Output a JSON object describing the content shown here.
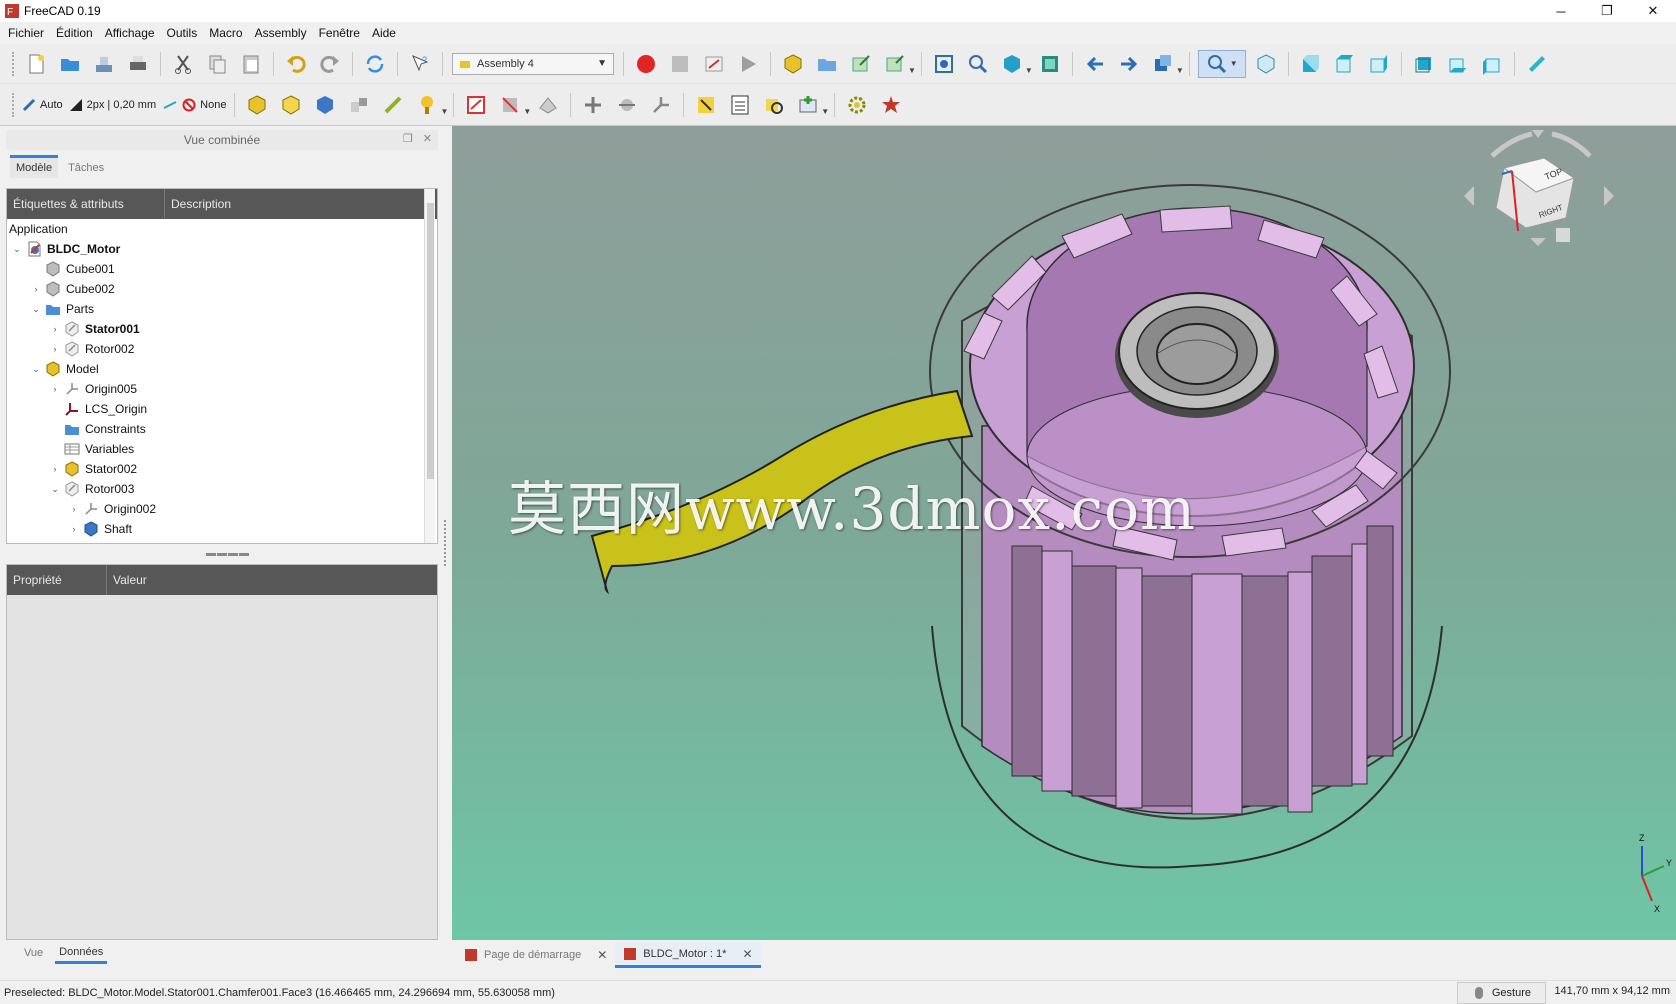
{
  "window": {
    "title": "FreeCAD 0.19",
    "minimize": "─",
    "restore": "❐",
    "close": "✕"
  },
  "menu": [
    "Fichier",
    "Édition",
    "Affichage",
    "Outils",
    "Macro",
    "Assembly",
    "Fenêtre",
    "Aide"
  ],
  "toolbar": {
    "workbench": "Assembly 4",
    "draw_mode": "Auto",
    "line_width": "2px | 0,20 mm",
    "grid_none": "None"
  },
  "combo_view": {
    "title": "Vue combinée",
    "tabs": [
      "Modèle",
      "Tâches"
    ],
    "tree_headers": [
      "Étiquettes & attributs",
      "Description"
    ],
    "tree": [
      {
        "label": "Application",
        "level": 0,
        "expander": "",
        "icon": "none",
        "bold": false
      },
      {
        "label": "BLDC_Motor",
        "level": 0,
        "expander": "v",
        "icon": "document",
        "bold": true
      },
      {
        "label": "Cube001",
        "level": 1,
        "expander": "",
        "icon": "cube-grey",
        "bold": false
      },
      {
        "label": "Cube002",
        "level": 1,
        "expander": ">",
        "icon": "cube-grey",
        "bold": false
      },
      {
        "label": "Parts",
        "level": 1,
        "expander": "v",
        "icon": "folder-blue",
        "bold": false
      },
      {
        "label": "Stator001",
        "level": 2,
        "expander": ">",
        "icon": "link-part",
        "bold": true
      },
      {
        "label": "Rotor002",
        "level": 2,
        "expander": ">",
        "icon": "link-part",
        "bold": false
      },
      {
        "label": "Model",
        "level": 1,
        "expander": "v",
        "icon": "model-yellow",
        "bold": false
      },
      {
        "label": "Origin005",
        "level": 2,
        "expander": ">",
        "icon": "axes",
        "bold": false
      },
      {
        "label": "LCS_Origin",
        "level": 2,
        "expander": "",
        "icon": "lcs",
        "bold": false
      },
      {
        "label": "Constraints",
        "level": 2,
        "expander": "",
        "icon": "folder-blue",
        "bold": false
      },
      {
        "label": "Variables",
        "level": 2,
        "expander": "",
        "icon": "table",
        "bold": false
      },
      {
        "label": "Stator002",
        "level": 2,
        "expander": ">",
        "icon": "model-yellow",
        "bold": false
      },
      {
        "label": "Rotor003",
        "level": 2,
        "expander": "v",
        "icon": "link-part",
        "bold": false
      },
      {
        "label": "Origin002",
        "level": 3,
        "expander": ">",
        "icon": "axes",
        "bold": false
      },
      {
        "label": "Shaft",
        "level": 3,
        "expander": ">",
        "icon": "body-blue",
        "bold": false
      }
    ],
    "prop_headers": [
      "Propriété",
      "Valeur"
    ],
    "bottom_tabs": [
      "Vue",
      "Données"
    ]
  },
  "viewport": {
    "watermark": "莫西网www.3dmox.com",
    "navcube_face": "RIGHT",
    "navcube_top": "TOP",
    "axes": {
      "x": "X",
      "y": "Y",
      "z": "Z"
    }
  },
  "doc_tabs": [
    {
      "label": "Page de démarrage",
      "active": false
    },
    {
      "label": "BLDC_Motor : 1*",
      "active": true
    }
  ],
  "status": {
    "preselected": "Preselected: BLDC_Motor.Model.Stator001.Chamfer001.Face3 (16.466465 mm, 24.296694 mm, 55.630058 mm)",
    "navigation": "Gesture",
    "dimensions": "141,70 mm x 94,12 mm"
  },
  "colors": {
    "accent": "#2d83d5",
    "rotor": "#c58fd0",
    "wire": "#c9c21a",
    "bg_top": "#8f9e9a",
    "bg_bottom": "#6ec6a6"
  }
}
